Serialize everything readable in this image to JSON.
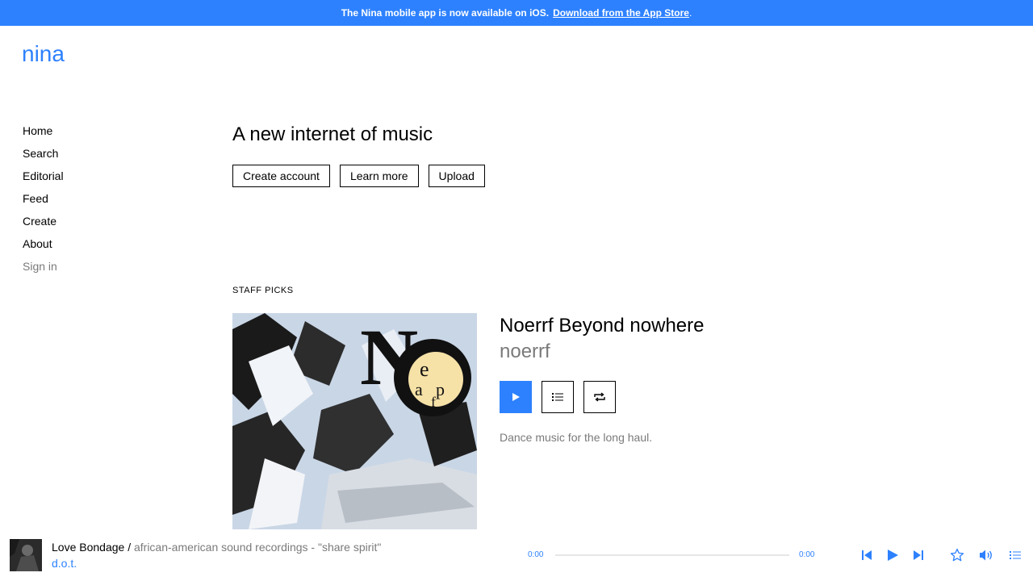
{
  "banner": {
    "text": "The Nina mobile app is now available on iOS.",
    "link": "Download from the App Store",
    "period": "."
  },
  "logo": {
    "text": "nina"
  },
  "nav": {
    "items": [
      {
        "label": "Home"
      },
      {
        "label": "Search"
      },
      {
        "label": "Editorial"
      },
      {
        "label": "Feed"
      },
      {
        "label": "Create"
      },
      {
        "label": "About"
      },
      {
        "label": "Sign in"
      }
    ]
  },
  "hero": {
    "headline": "A new internet of music",
    "buttons": {
      "create": "Create account",
      "learn": "Learn more",
      "upload": "Upload"
    }
  },
  "staff_picks": {
    "label": "STAFF PICKS",
    "release": {
      "title": "Noerrf Beyond nowhere",
      "artist": "noerrf",
      "description": "Dance music for the long haul."
    }
  },
  "player": {
    "track": "Love Bondage",
    "separator": " / ",
    "release": "african-american sound recordings - \"share spirit\"",
    "artist": "d.o.t.",
    "time_current": "0:00",
    "time_total": "0:00"
  },
  "colors": {
    "accent": "#2D81FF",
    "muted": "#7a7a7a"
  },
  "icons": [
    "play-icon",
    "queue-icon",
    "repost-icon",
    "previous-icon",
    "next-icon",
    "star-icon",
    "volume-icon",
    "list-icon"
  ]
}
